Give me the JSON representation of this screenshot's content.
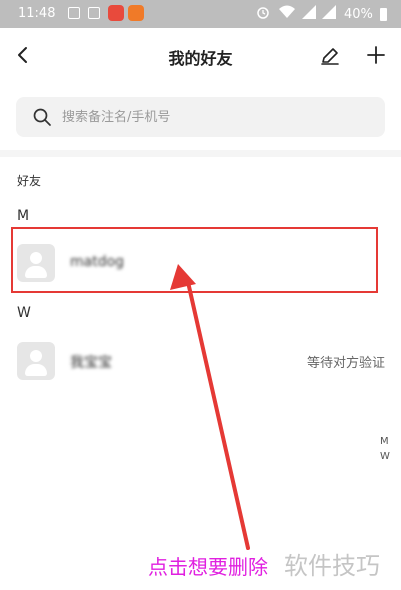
{
  "status_bar": {
    "time": "11:48",
    "battery": "40%"
  },
  "header": {
    "title": "我的好友",
    "back_icon": "chevron-left-icon",
    "edit_icon": "pencil-icon",
    "add_icon": "plus-icon"
  },
  "search": {
    "placeholder": "搜索备注名/手机号",
    "value": ""
  },
  "friends_section": {
    "label": "好友"
  },
  "groups": [
    {
      "letter": "M",
      "contacts": [
        {
          "name": "matdog",
          "status": ""
        }
      ]
    },
    {
      "letter": "W",
      "contacts": [
        {
          "name": "我宝宝",
          "status": "等待对方验证"
        }
      ]
    }
  ],
  "index_bar": [
    "M",
    "W"
  ],
  "annotation": {
    "caption": "点击想要删除",
    "watermark": "软件技巧",
    "color": "#e53935"
  }
}
